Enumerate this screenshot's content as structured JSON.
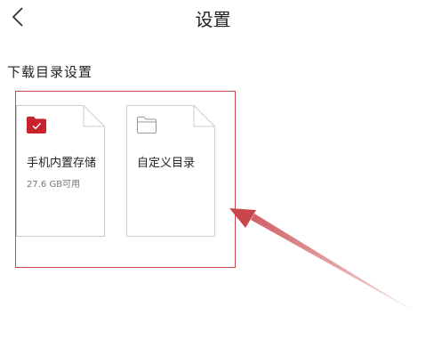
{
  "header": {
    "title": "设置",
    "back_icon": "chevron-left-icon"
  },
  "download_dir": {
    "section_title": "下载目录设置",
    "options": [
      {
        "title": "手机内置存储",
        "subtitle": "27.6 GB可用",
        "selected": true,
        "icon": "folder-check-icon"
      },
      {
        "title": "自定义目录",
        "icon": "folder-outline-icon"
      }
    ]
  },
  "colors": {
    "accent": "#c8232c",
    "annotation": "#c8464c",
    "card_border": "#cccccc"
  }
}
